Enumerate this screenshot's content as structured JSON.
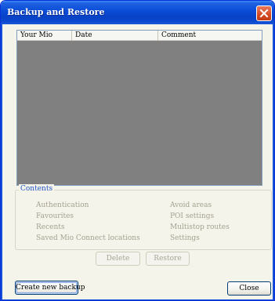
{
  "window": {
    "title": "Backup and Restore"
  },
  "listview": {
    "columns": [
      "Your Mio",
      "Date",
      "Comment"
    ]
  },
  "contents": {
    "legend": "Contents",
    "left_items": [
      "Authentication",
      "Favourites",
      "Recents",
      "Saved Mio Connect locations"
    ],
    "right_items": [
      "Avoid areas",
      "POI settings",
      "Multistop routes",
      "Settings"
    ]
  },
  "buttons": {
    "delete": "Delete",
    "restore": "Restore",
    "create": "Create new backup",
    "close": "Close"
  },
  "colors": {
    "titlebar": "#0a4bd6",
    "list_background": "#808080",
    "legend_text": "#2154c8",
    "disabled_text": "#a3a18f"
  }
}
